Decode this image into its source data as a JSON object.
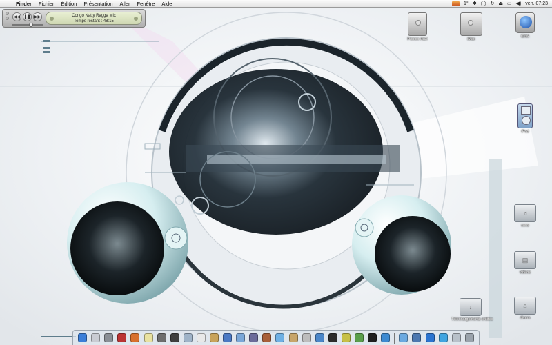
{
  "menubar": {
    "apple_glyph": "",
    "items": [
      "Finder",
      "Fichier",
      "Édition",
      "Présentation",
      "Aller",
      "Fenêtre",
      "Aide"
    ],
    "temperature": "1°",
    "clock": "ven. 07:23"
  },
  "player": {
    "track": "Congo Natty Ragga Mix",
    "time_remaining": "Temps restant : 48:15"
  },
  "desktop_icons": {
    "disk1": "Porxxx HaX",
    "disk2": "iMax",
    "disk3": "iDisk",
    "ipod": "iPod",
    "folder_sons": "sons",
    "folder_videos": "videos",
    "folder_dl": "Téléchargements entités",
    "folder_divers": "divers"
  },
  "icon_names": {
    "disk1": "hard-drive-icon",
    "disk2": "hard-drive-icon",
    "disk3": "idisk-globe-icon",
    "ipod": "ipod-icon",
    "folders": "folder-icon"
  },
  "dock": {
    "items": [
      {
        "name": "finder",
        "color": "#3b7ed8"
      },
      {
        "name": "mail",
        "color": "#c9ccd3"
      },
      {
        "name": "app-3",
        "color": "#8a8f96"
      },
      {
        "name": "app-4",
        "color": "#b33"
      },
      {
        "name": "app-5",
        "color": "#d8702e"
      },
      {
        "name": "app-6",
        "color": "#e9e2a0"
      },
      {
        "name": "app-7",
        "color": "#6d6d6d"
      },
      {
        "name": "app-8",
        "color": "#3f3f3f"
      },
      {
        "name": "app-9",
        "color": "#9fb3c8"
      },
      {
        "name": "ical",
        "color": "#e8e8e8"
      },
      {
        "name": "app-11",
        "color": "#c8a35a"
      },
      {
        "name": "app-12",
        "color": "#4a79c4"
      },
      {
        "name": "app-13",
        "color": "#7aa7d8"
      },
      {
        "name": "app-14",
        "color": "#6b6b9a"
      },
      {
        "name": "app-15",
        "color": "#a85f3a"
      },
      {
        "name": "itunes",
        "color": "#6fb0e4"
      },
      {
        "name": "garageband",
        "color": "#c7a56a"
      },
      {
        "name": "app-18",
        "color": "#bdbdbd"
      },
      {
        "name": "app-19",
        "color": "#4b87c9"
      },
      {
        "name": "app-20",
        "color": "#2c2c2c"
      },
      {
        "name": "app-21",
        "color": "#c7c047"
      },
      {
        "name": "app-22",
        "color": "#5a9e4b"
      },
      {
        "name": "app-23",
        "color": "#1f1f1f"
      },
      {
        "name": "app-24",
        "color": "#3d8ad1"
      },
      {
        "name": "app-25",
        "color": "#6aa9e0"
      },
      {
        "name": "app-26",
        "color": "#4c78b0"
      },
      {
        "name": "app-27",
        "color": "#2b74d0"
      },
      {
        "name": "app-28",
        "color": "#3fa4e0"
      },
      {
        "name": "app-29",
        "color": "#b8c1ca"
      },
      {
        "name": "trash",
        "color": "#9aa3ac"
      }
    ]
  }
}
